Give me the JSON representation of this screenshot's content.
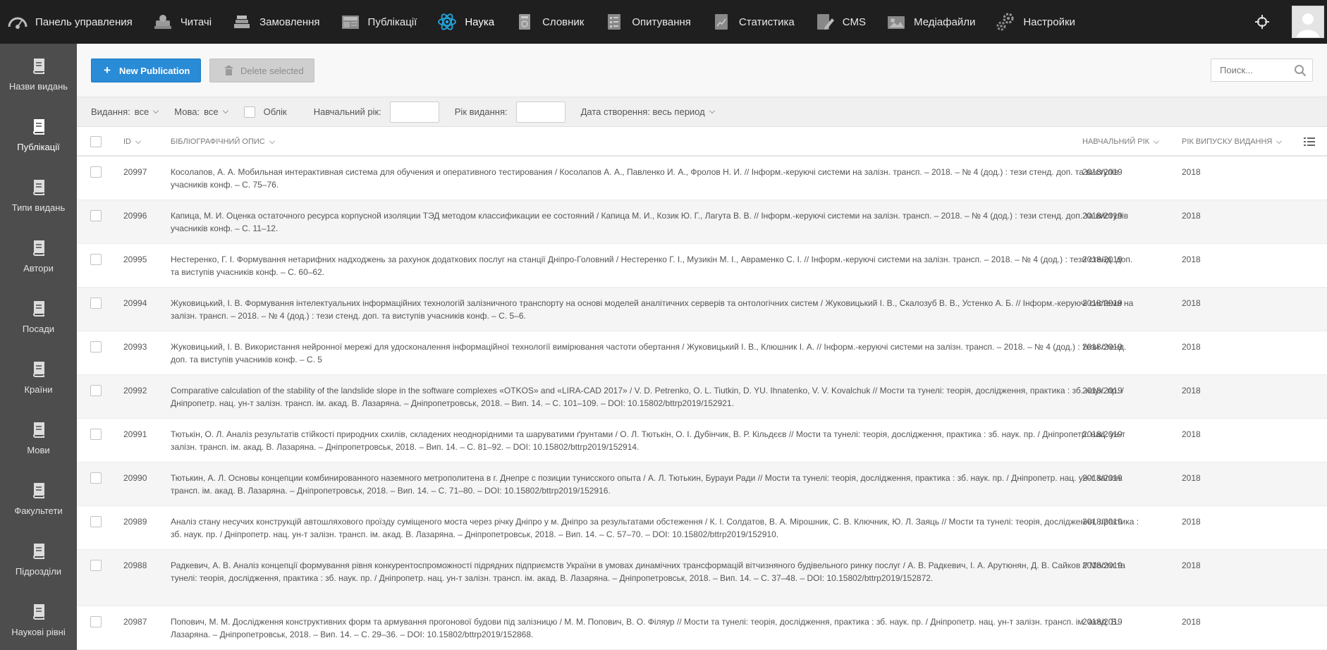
{
  "topnav": {
    "items": [
      {
        "label": "Панель управления",
        "icon": "dashboard-icon"
      },
      {
        "label": "Читачі",
        "icon": "readers-icon"
      },
      {
        "label": "Замовлення",
        "icon": "orders-icon"
      },
      {
        "label": "Публікації",
        "icon": "news-icon"
      },
      {
        "label": "Наука",
        "icon": "atom-icon",
        "active": true
      },
      {
        "label": "Словник",
        "icon": "dictionary-icon"
      },
      {
        "label": "Опитування",
        "icon": "survey-icon"
      },
      {
        "label": "Статистика",
        "icon": "statistics-icon"
      },
      {
        "label": "CMS",
        "icon": "cms-icon"
      },
      {
        "label": "Медіафайли",
        "icon": "media-icon"
      },
      {
        "label": "Настройки",
        "icon": "settings-icon"
      }
    ]
  },
  "sidebar": {
    "items": [
      {
        "label": "Назви видань",
        "icon": "book-icon"
      },
      {
        "label": "Публікації",
        "icon": "book-icon",
        "active": true
      },
      {
        "label": "Типи видань",
        "icon": "book-icon"
      },
      {
        "label": "Автори",
        "icon": "book-icon"
      },
      {
        "label": "Посади",
        "icon": "book-icon"
      },
      {
        "label": "Країни",
        "icon": "book-icon"
      },
      {
        "label": "Мови",
        "icon": "book-icon"
      },
      {
        "label": "Факультети",
        "icon": "book-icon"
      },
      {
        "label": "Підрозділи",
        "icon": "book-icon"
      },
      {
        "label": "Наукові рівні",
        "icon": "book-icon"
      }
    ]
  },
  "toolbar": {
    "new_label": "New Publication",
    "delete_label": "Delete selected",
    "search_placeholder": "Поиск..."
  },
  "filters": {
    "edition_label": "Видання:",
    "edition_value": "все",
    "language_label": "Мова:",
    "language_value": "все",
    "accounting_label": "Облік",
    "academic_year_label": "Навчальний рік:",
    "academic_year_value": "",
    "pub_year_label": "Рік видання:",
    "pub_year_value": "",
    "created_label": "Дата створення: весь период"
  },
  "table": {
    "headers": {
      "id": "ID",
      "description": "БІБЛІОГРАФІЧНИЙ ОПИС",
      "academic_year": "НАВЧАЛЬНИЙ РІК",
      "pub_year": "РІК ВИПУСКУ ВИДАННЯ"
    },
    "rows": [
      {
        "id": "20997",
        "desc": "Косолапов, А. А. Мобильная интерактивная система для обучения и оперативного тестирования / Косолапов А. А., Павленко И. А., Фролов Н. И. // Інформ.-керуючі системи на залізн. трансп. – 2018. – № 4 (дод.) : тези стенд. доп. та виступів учасників конф. – С. 75–76.",
        "year": "2018/2019",
        "pub": "2018"
      },
      {
        "id": "20996",
        "desc": "Капица, М. И. Оценка остаточного ресурса корпусной изоляции ТЭД методом классификации ее состояний / Капица М. И., Козик Ю. Г., Лагута В. В. // Інформ.-керуючі системи на залізн. трансп. – 2018. – № 4 (дод.) : тези стенд. доп. та виступів учасників конф. – С. 11–12.",
        "year": "2018/2019",
        "pub": "2018"
      },
      {
        "id": "20995",
        "desc": "Нестеренко, Г. І. Формування нетарифних надходжень за рахунок додаткових послуг на станції Дніпро-Головний / Нестеренко Г. І., Музикін М. І., Авраменко С. І. // Інформ.-керуючі системи на залізн. трансп. – 2018. – № 4 (дод.) : тези стенд. доп. та виступів учасників конф. – С. 60–62.",
        "year": "2018/2019",
        "pub": "2018"
      },
      {
        "id": "20994",
        "desc": "Жуковицький, І. В. Формування інтелектуальних інформаційних технологій залізничного транспорту на основі моделей аналітичних серверів та онтологічних систем / Жуковицький І. В., Скалозуб В. В., Устенко А. Б. // Інформ.-керуючі системи на залізн. трансп. – 2018. – № 4 (дод.) : тези стенд. доп. та виступів учасників конф. – С. 5–6.",
        "year": "2018/2019",
        "pub": "2018"
      },
      {
        "id": "20993",
        "desc": "Жуковицький, І. В. Використання нейронної мережі для удосконалення інформаційної технології вимірювання частоти обертання / Жуковицький І. В., Клюшник І. А. // Інформ.-керуючі системи на залізн. трансп. – 2018. – № 4 (дод.) : тези стенд. доп. та виступів учасників конф. – С. 5",
        "year": "2018/2019",
        "pub": "2018"
      },
      {
        "id": "20992",
        "desc": "Comparative calculation of the stability of the landslide slope in the software complexes «OTKOS» and «LIRA-CAD 2017» / V. D. Petrenko, O. L. Tiutkin, D. YU. Ihnatenko, V. V. Kovalchuk // Мости та тунелі: теорія, дослідження, практика : зб. наук. пр. / Дніпропетр. нац. ун-т залізн. трансп. ім. акад. В. Лазаряна. – Дніпропетровськ, 2018. – Вип. 14. – С. 101–109. – DOI: 10.15802/bttrp2019/152921.",
        "year": "2018/2019",
        "pub": "2018"
      },
      {
        "id": "20991",
        "desc": "Тютькін, О. Л. Аналіз результатів стійкості природних схилів, складених неоднорідними та шаруватими ґрунтами / О. Л. Тютькін, О. І. Дубінчик, В. Р. Кільдєєв // Мости та тунелі: теорія, дослідження, практика : зб. наук. пр. / Дніпропетр. нац. ун-т залізн. трансп. ім. акад. В. Лазаряна. – Дніпропетровськ, 2018. – Вип. 14. – С. 81–92. – DOI: 10.15802/bttrp2019/152914.",
        "year": "2018/2019",
        "pub": "2018"
      },
      {
        "id": "20990",
        "desc": "Тютькин, А. Л. Основы концепции комбинированного наземного метрополитена в г. Днепре с позиции тунисского опыта / А. Л. Тютькин, Бурауи Ради // Мости та тунелі: теорія, дослідження, практика : зб. наук. пр. / Дніпропетр. нац. ун-т залізн. трансп. ім. акад. В. Лазаряна. – Дніпропетровськ, 2018. – Вип. 14. – С. 71–80. – DOI: 10.15802/bttrp2019/152916.",
        "year": "2018/2019",
        "pub": "2018"
      },
      {
        "id": "20989",
        "desc": "Аналіз стану несучих конструкцій автошляхового проїзду суміщеного моста через річку Дніпро у м. Дніпро за результатами обстеження / К. І. Солдатов, В. А. Мірошник, С. В. Ключник, Ю. Л. Заяць // Мости та тунелі: теорія, дослідження, практика : зб. наук. пр. / Дніпропетр. нац. ун-т залізн. трансп. ім. акад. В. Лазаряна. – Дніпропетровськ, 2018. – Вип. 14. – С. 57–70. – DOI: 10.15802/bttrp2019/152910.",
        "year": "2018/2019",
        "pub": "2018"
      },
      {
        "id": "20988",
        "desc": "Радкевич, А. В. Аналіз концепції формування рівня конкурентоспроможності підрядних підприємств України в умовах динамічних трансформацій вітчизняного будівельного ринку послуг / А. В. Радкевич, І. А. Арутюнян, Д. В. Сайков // Мости та тунелі: теорія, дослідження, практика : зб. наук. пр. / Дніпропетр. нац. ун-т залізн. трансп. ім. акад. В. Лазаряна. – Дніпропетровськ, 2018. – Вип. 14. – С. 37–48. – DOI: 10.15802/bttrp2019/152872.",
        "year": "2018/2019",
        "pub": "2018"
      },
      {
        "id": "20987",
        "desc": "Попович, М. М. Дослідження конструктивних форм та армування прогонової будови під залізницю / М. М. Попович, В. О. Філяур // Мости та тунелі: теорія, дослідження, практика : зб. наук. пр. / Дніпропетр. нац. ун-т залізн. трансп. ім. акад. В. Лазаряна. – Дніпропетровськ, 2018. – Вип. 14. – С. 29–36. – DOI: 10.15802/bttrp2019/152868.",
        "year": "2018/2019",
        "pub": "2018"
      }
    ]
  }
}
